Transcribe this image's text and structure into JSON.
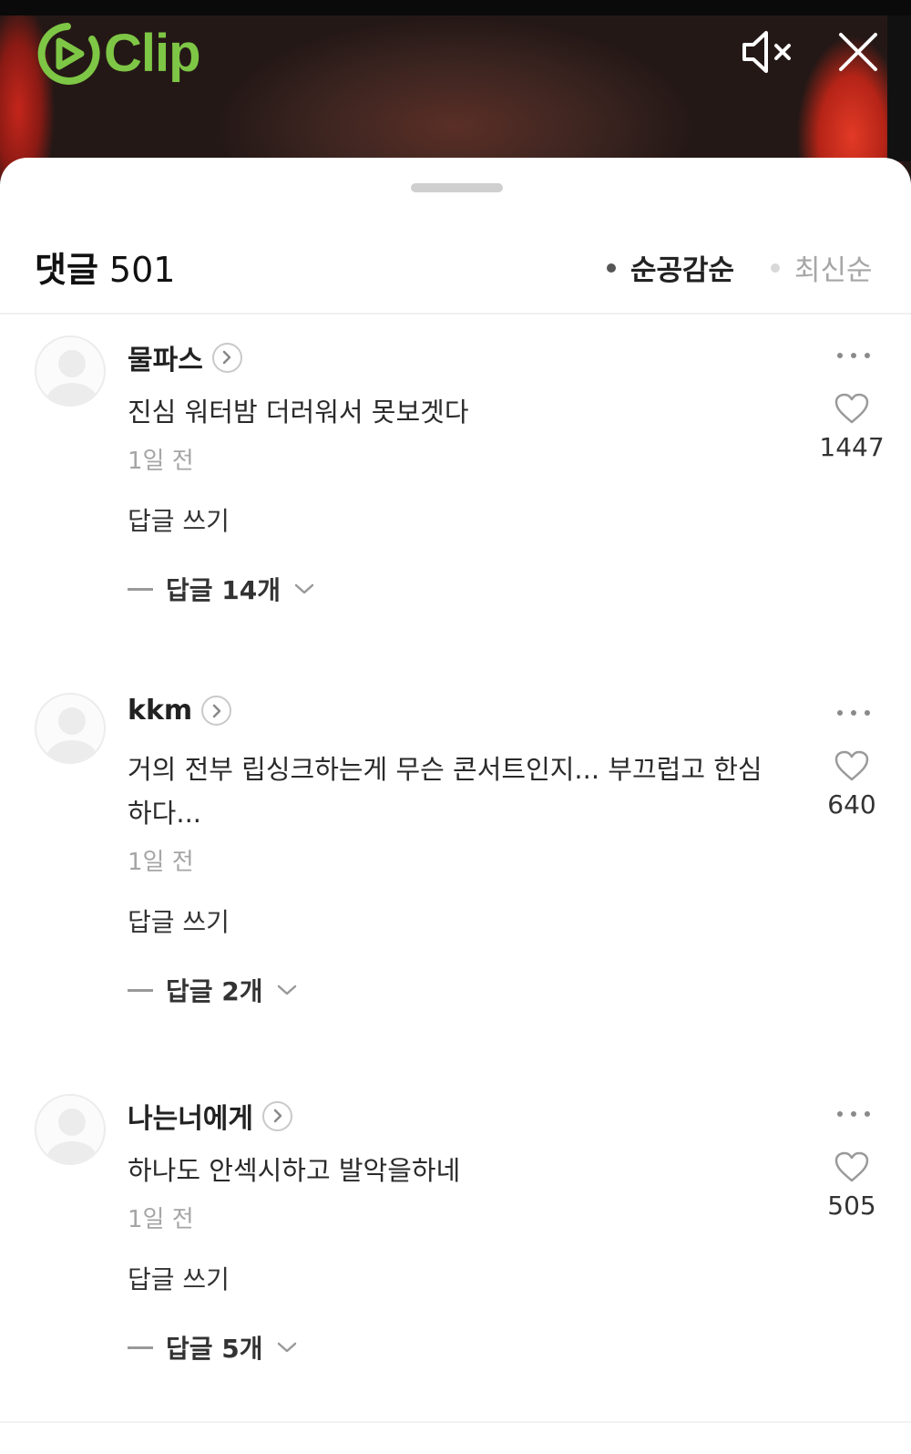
{
  "player": {
    "logo_text": "Clip",
    "brand_color": "#7ec645",
    "mute_icon": "speaker-muted-icon",
    "close_icon": "close-icon"
  },
  "comments_panel": {
    "title": "댓글",
    "count": "501",
    "sort": {
      "popular": "순공감순",
      "recent": "최신순",
      "active": "popular"
    }
  },
  "comments": [
    {
      "author": "물파스",
      "text": "진심 워터밤 더러워서 못보겟다",
      "time": "1일 전",
      "reply_write": "답글 쓰기",
      "replies": "답글 14개",
      "likes": "1447"
    },
    {
      "author": "kkm",
      "text": "거의 전부 립싱크하는게 무슨 콘서트인지... 부끄럽고 한심하다...",
      "time": "1일 전",
      "reply_write": "답글 쓰기",
      "replies": "답글 2개",
      "likes": "640"
    },
    {
      "author": "나는너에게",
      "text": "하나도 안섹시하고 발악을하네",
      "time": "1일 전",
      "reply_write": "답글 쓰기",
      "replies": "답글 5개",
      "likes": "505"
    }
  ]
}
